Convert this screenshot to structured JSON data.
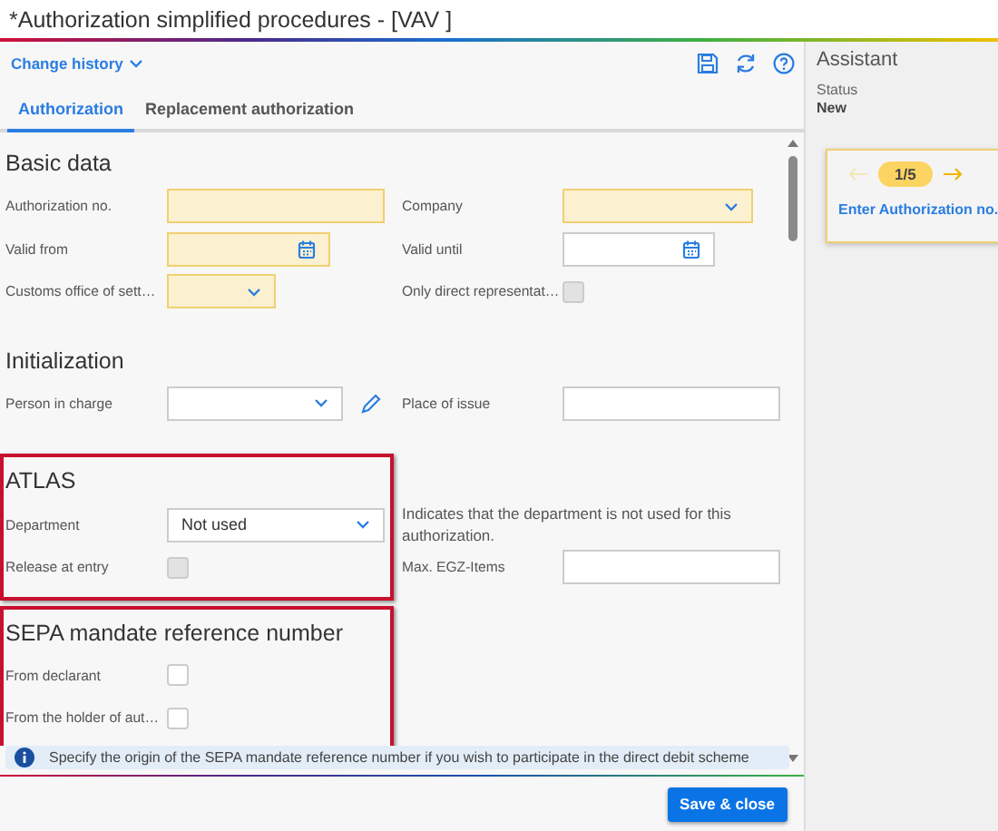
{
  "window": {
    "title": "*Authorization simplified procedures - [VAV ]"
  },
  "header": {
    "history_link": "Change history"
  },
  "tabs": [
    {
      "label": "Authorization",
      "selected": true
    },
    {
      "label": "Replacement authorization",
      "selected": false
    }
  ],
  "sections": [
    {
      "title": "Basic data",
      "highlighted": false,
      "rows": [
        {
          "left": {
            "label": "Authorization no.",
            "kind": "text",
            "required": true
          },
          "right": {
            "label": "Company",
            "kind": "select",
            "required": true
          }
        },
        {
          "left": {
            "label": "Valid from",
            "kind": "date",
            "required": true
          },
          "right": {
            "label": "Valid until",
            "kind": "date",
            "required": false
          }
        },
        {
          "left": {
            "label": "Customs office of sett…",
            "kind": "select",
            "required": true
          },
          "right": {
            "label": "Only direct representat…",
            "kind": "checkbox",
            "checked": false,
            "disabled": true
          }
        }
      ]
    },
    {
      "title": "Initialization",
      "highlighted": false,
      "rows": [
        {
          "left": {
            "label": "Person in charge",
            "kind": "select",
            "required": false,
            "editable": true
          },
          "right": {
            "label": "Place of issue",
            "kind": "text",
            "required": false
          }
        }
      ]
    },
    {
      "title": "ATLAS",
      "highlighted": true,
      "rows": [
        {
          "left": {
            "label": "Department",
            "kind": "select",
            "required": false,
            "value": "Not used"
          },
          "right": {
            "kind": "note",
            "text": "Indicates that the department is not used for this authorization."
          }
        },
        {
          "left": {
            "label": "Release at entry",
            "kind": "checkbox",
            "checked": false,
            "disabled": true
          },
          "right": {
            "label": "Max. EGZ-Items",
            "kind": "text",
            "required": false
          }
        }
      ]
    },
    {
      "title": "SEPA mandate reference number",
      "highlighted": true,
      "rows": [
        {
          "left": {
            "label": "From declarant",
            "kind": "checkbox",
            "checked": false,
            "disabled": false
          }
        },
        {
          "left": {
            "label": "From the holder of aut…",
            "kind": "checkbox",
            "checked": false,
            "disabled": false
          }
        }
      ]
    }
  ],
  "info_bar": {
    "text": "Specify the origin of the SEPA mandate reference number if you wish to participate in the direct debit scheme"
  },
  "footer": {
    "button": "Save & close"
  },
  "assistant": {
    "title": "Assistant",
    "status_label": "Status",
    "status": "New",
    "step": "1/5",
    "prev_disabled": true,
    "next_disabled": false,
    "hint": "Enter Authorization no."
  }
}
